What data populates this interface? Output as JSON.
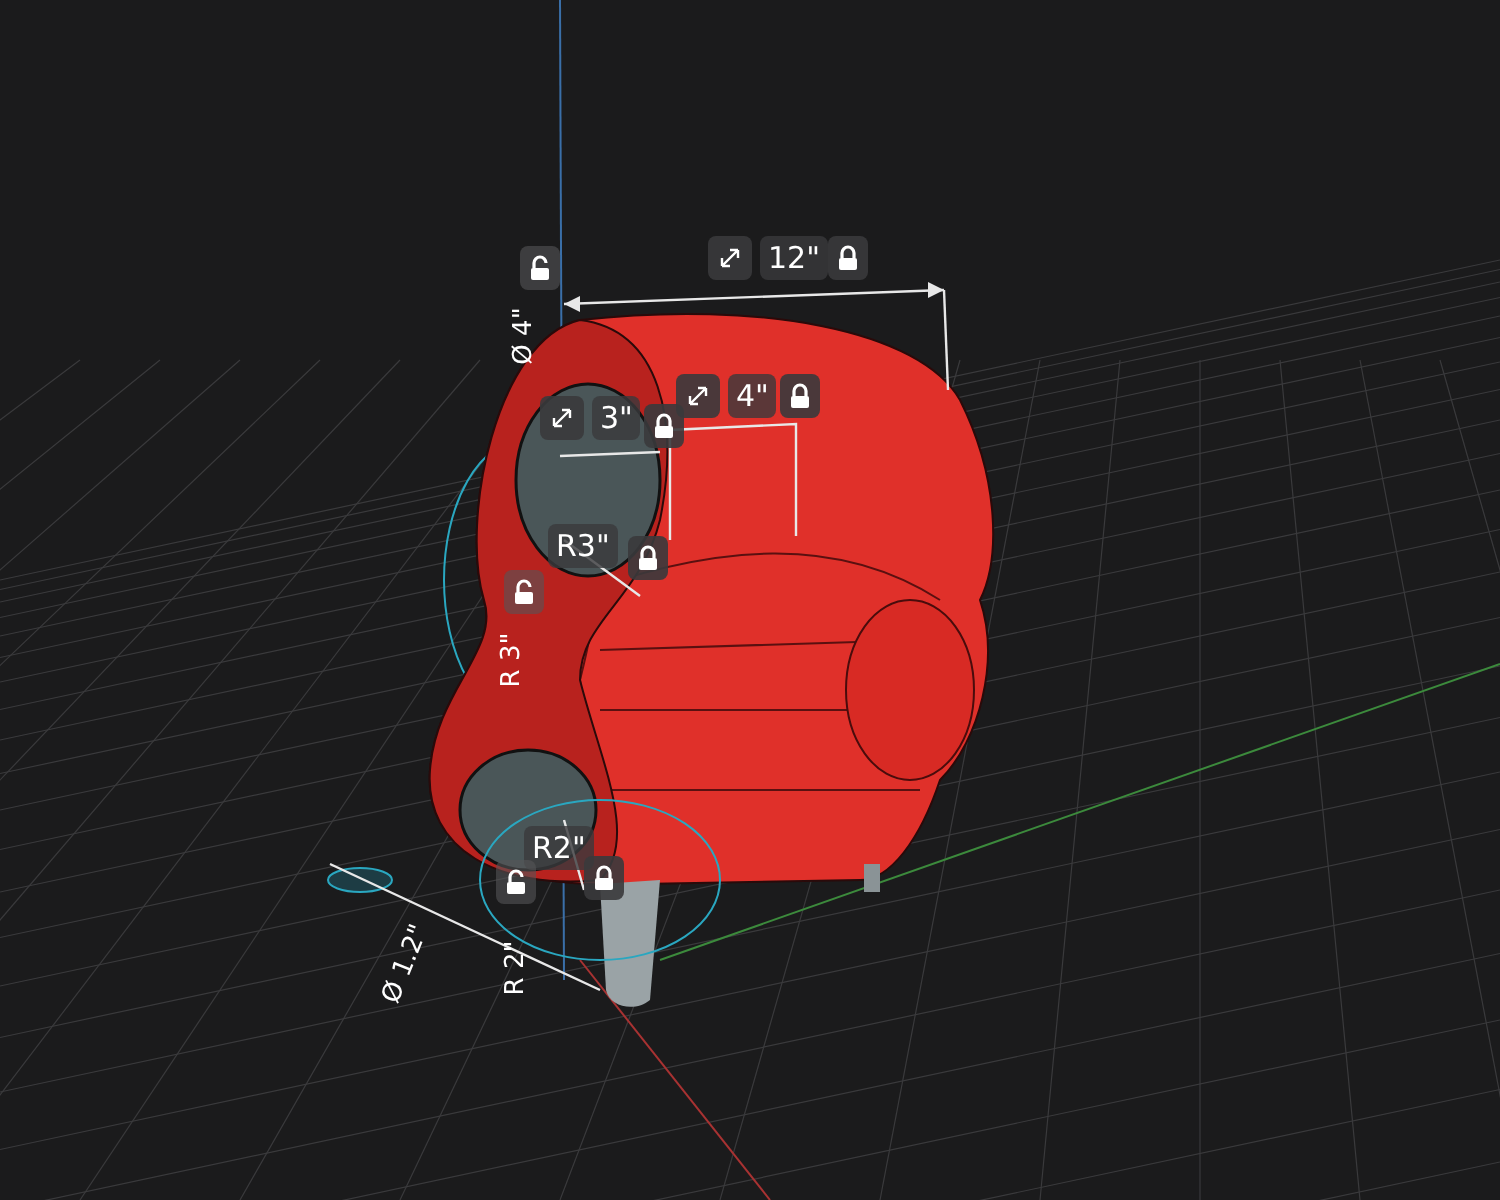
{
  "viewport": {
    "dimension_labels": [
      {
        "label": "12\"",
        "kind": "tile"
      },
      {
        "label": "3\"",
        "kind": "tile"
      },
      {
        "label": "4\"",
        "kind": "tile"
      },
      {
        "label": "R3\"",
        "kind": "tile"
      },
      {
        "label": "R2\"",
        "kind": "tile"
      },
      {
        "label": "Ø 4\"",
        "kind": "rotated"
      },
      {
        "label": "R 3\"",
        "kind": "rotated"
      },
      {
        "label": "Ø 1.2\"",
        "kind": "rotated"
      },
      {
        "label": "R 2\"",
        "kind": "rotated"
      }
    ],
    "lock_toggles": [
      {
        "locked": true
      },
      {
        "locked": true
      },
      {
        "locked": true
      },
      {
        "locked": true
      },
      {
        "locked": true
      },
      {
        "locked": false
      },
      {
        "locked": false
      },
      {
        "locked": false
      }
    ]
  }
}
